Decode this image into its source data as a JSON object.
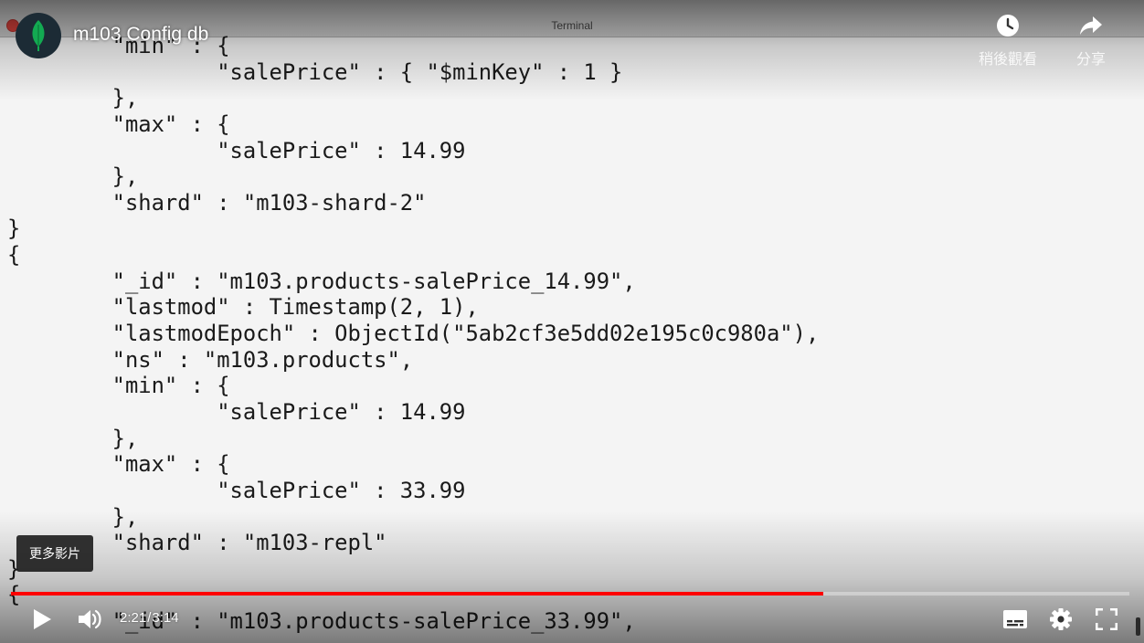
{
  "terminal_window": {
    "title": "Terminal"
  },
  "video": {
    "title": "m103 Config db",
    "current_time": "2:21",
    "time_separator": "/",
    "duration": "3:14",
    "progress_fraction": 0.7266
  },
  "top_actions": {
    "watch_later": "稍後觀看",
    "share": "分享"
  },
  "tooltip": {
    "more_videos": "更多影片"
  },
  "terminal_lines": [
    "        \"min\" : {",
    "                \"salePrice\" : { \"$minKey\" : 1 }",
    "        },",
    "        \"max\" : {",
    "                \"salePrice\" : 14.99",
    "        },",
    "        \"shard\" : \"m103-shard-2\"",
    "}",
    "{",
    "        \"_id\" : \"m103.products-salePrice_14.99\",",
    "        \"lastmod\" : Timestamp(2, 1),",
    "        \"lastmodEpoch\" : ObjectId(\"5ab2cf3e5dd02e195c0c980a\"),",
    "        \"ns\" : \"m103.products\",",
    "        \"min\" : {",
    "                \"salePrice\" : 14.99",
    "        },",
    "        \"max\" : {",
    "                \"salePrice\" : 33.99",
    "        },",
    "        \"shard\" : \"m103-repl\"",
    "}",
    "{",
    "        \"_id\" : \"m103.products-salePrice_33.99\","
  ],
  "icons": {
    "avatar": "mongodb-leaf-icon",
    "watch_later": "clock-icon",
    "share": "share-arrow-icon",
    "play": "play-icon",
    "volume": "volume-icon",
    "subtitles": "subtitles-icon",
    "settings": "gear-icon",
    "fullscreen": "fullscreen-icon"
  },
  "colors": {
    "progress": "#ff0000",
    "avatar_bg": "#1c2b35",
    "leaf": "#13aa52"
  }
}
